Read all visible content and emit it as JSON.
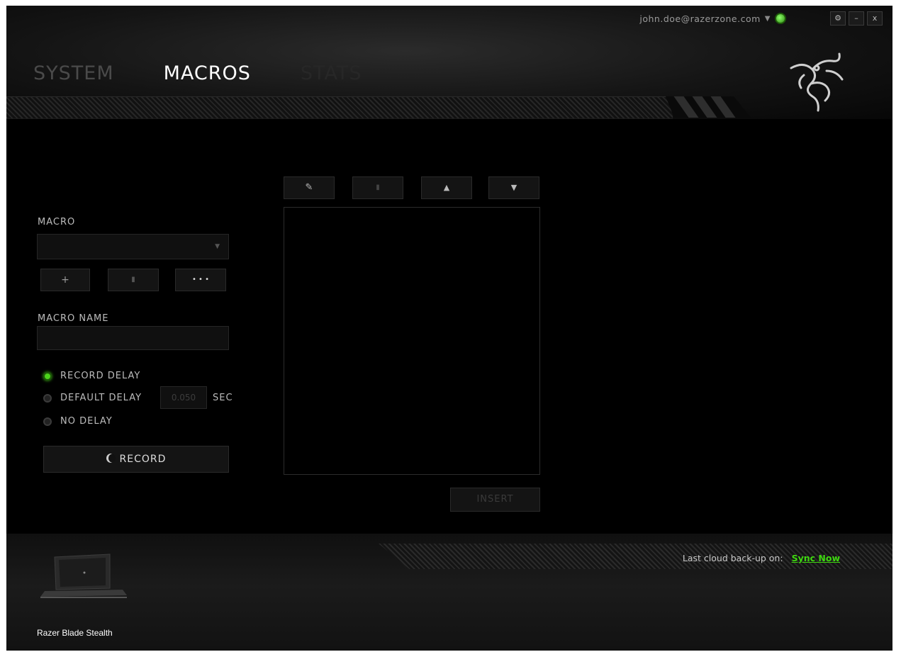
{
  "user": {
    "email": "john.doe@razerzone.com"
  },
  "window_controls": {
    "settings": "⚙",
    "minimize": "–",
    "close": "x"
  },
  "tabs": [
    {
      "label": "SYSTEM"
    },
    {
      "label": "MACROS"
    },
    {
      "label": "STATS"
    }
  ],
  "macro_section": {
    "macro_label": "MACRO",
    "add_icon": "+",
    "delete_icon": "▮",
    "more_icon": "• • •",
    "macro_name_label": "MACRO NAME"
  },
  "delay_options": [
    {
      "label": "RECORD DELAY",
      "selected": true
    },
    {
      "label": "DEFAULT DELAY",
      "selected": false
    },
    {
      "label": "NO DELAY",
      "selected": false
    }
  ],
  "default_delay": {
    "value": "0.050",
    "unit": "SEC"
  },
  "record_button": {
    "label": "RECORD"
  },
  "toolbar_icons": {
    "edit": "✎",
    "delete": "▮",
    "up": "▲",
    "down": "▼"
  },
  "insert_button": {
    "label": "INSERT"
  },
  "footer": {
    "cloud_text": "Last cloud back-up on:",
    "sync_label": "Sync Now",
    "device_name": "Razer Blade Stealth"
  },
  "colors": {
    "accent": "#44d62c",
    "background": "#000000"
  }
}
